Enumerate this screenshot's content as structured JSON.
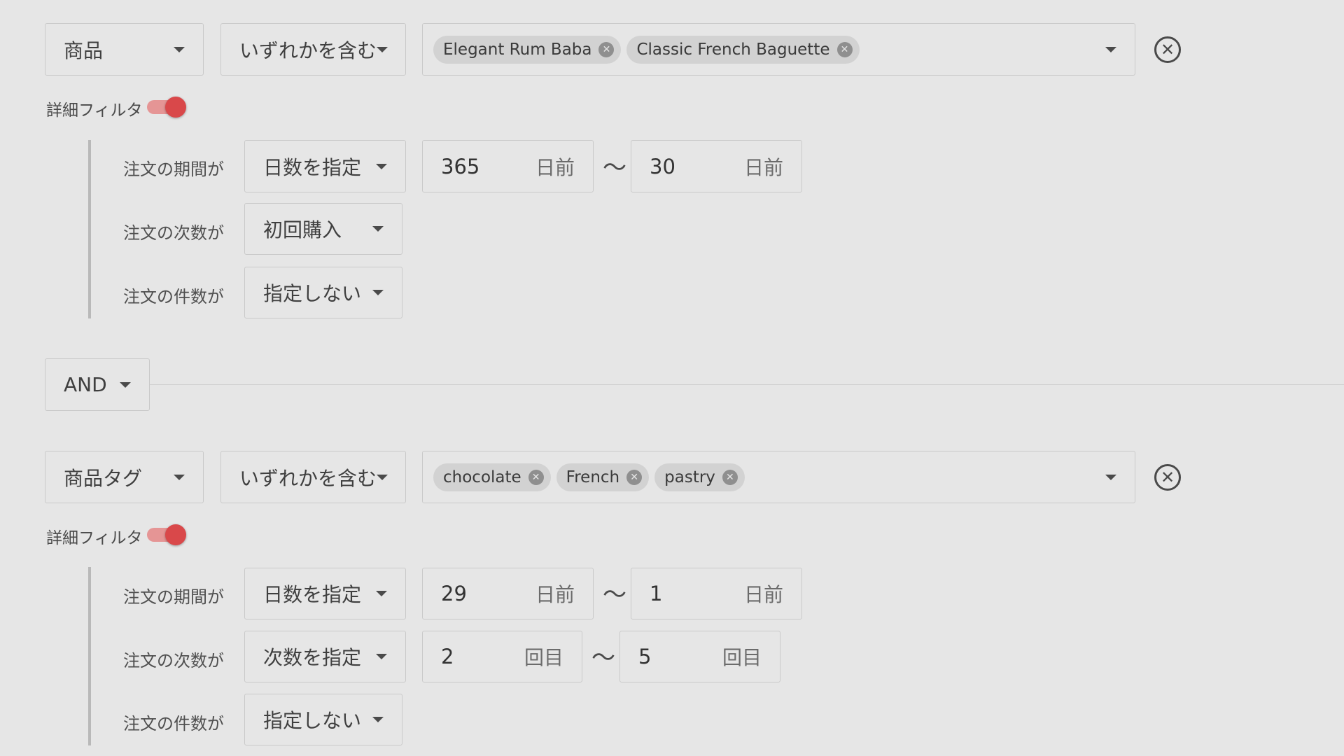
{
  "filter1": {
    "field": "商品",
    "operator": "いずれかを含む",
    "chips": [
      "Elegant Rum Baba",
      "Classic French Baguette"
    ],
    "detail_label": "詳細フィルタ",
    "period": {
      "label": "注文の期間が",
      "mode": "日数を指定",
      "from": "365",
      "from_unit": "日前",
      "tilde": "〜",
      "to": "30",
      "to_unit": "日前"
    },
    "order_count": {
      "label": "注文の次数が",
      "mode": "初回購入"
    },
    "order_number": {
      "label": "注文の件数が",
      "mode": "指定しない"
    }
  },
  "logic": {
    "value": "AND"
  },
  "filter2": {
    "field": "商品タグ",
    "operator": "いずれかを含む",
    "chips": [
      "chocolate",
      "French",
      "pastry"
    ],
    "detail_label": "詳細フィルタ",
    "period": {
      "label": "注文の期間が",
      "mode": "日数を指定",
      "from": "29",
      "from_unit": "日前",
      "tilde": "〜",
      "to": "1",
      "to_unit": "日前"
    },
    "order_count": {
      "label": "注文の次数が",
      "mode": "次数を指定",
      "from": "2",
      "from_unit": "回目",
      "tilde": "〜",
      "to": "5",
      "to_unit": "回目"
    },
    "order_number": {
      "label": "注文の件数が",
      "mode": "指定しない"
    }
  },
  "icons": {
    "clear": "circle-x-icon",
    "chip_remove": "chip-close-icon",
    "dropdown": "caret-down-icon"
  },
  "colors": {
    "toggle_on": "#d9484a",
    "toggle_track": "#e59595",
    "background": "#e6e6e6"
  }
}
